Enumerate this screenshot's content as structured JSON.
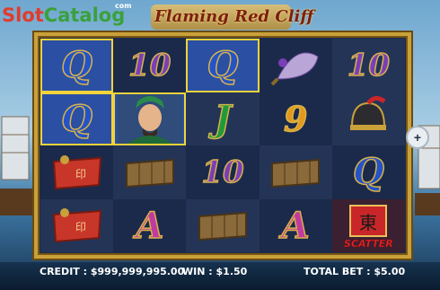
{
  "branding": {
    "logo_slot": "Slot",
    "logo_catalog": "Catalog",
    "logo_com": "com",
    "game_title": "Flaming Red Cliff"
  },
  "reels": [
    [
      "Q",
      "10",
      "Q",
      "fan",
      "10"
    ],
    [
      "Q",
      "general",
      "J",
      "9",
      "helmet"
    ],
    [
      "token",
      "scroll",
      "10",
      "scroll",
      "Q"
    ],
    [
      "token",
      "A",
      "scroll",
      "A",
      "scatter"
    ]
  ],
  "scatter": {
    "glyph": "東",
    "label": "SCATTER"
  },
  "status": {
    "credit_label": "CREDIT :",
    "credit_value": "$999,999,995.00",
    "win_label": "WIN :",
    "win_value": "$1.50",
    "bet_label": "TOTAL BET :",
    "bet_value": "$5.00"
  },
  "colors": {
    "frame_gold": "#c9a13a",
    "win_highlight": "#f1d33a",
    "bar": "#0b1b2e"
  }
}
